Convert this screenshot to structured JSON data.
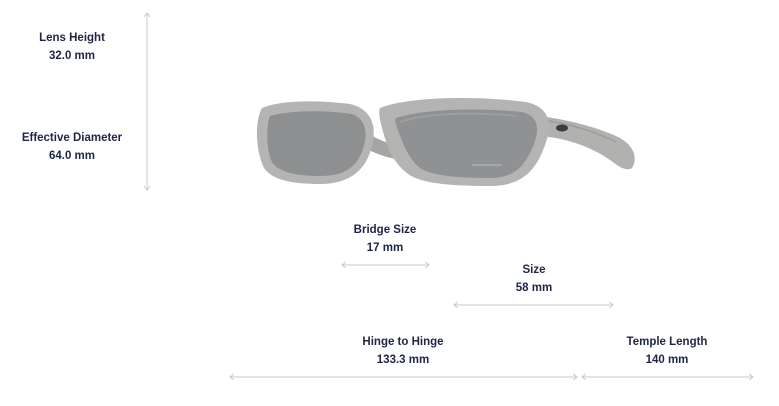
{
  "measurements": {
    "lens_height": {
      "label": "Lens Height",
      "value": "32.0 mm"
    },
    "effective_diameter": {
      "label": "Effective Diameter",
      "value": "64.0 mm"
    },
    "bridge_size": {
      "label": "Bridge Size",
      "value": "17 mm"
    },
    "size": {
      "label": "Size",
      "value": "58 mm"
    },
    "hinge_to_hinge": {
      "label": "Hinge to Hinge",
      "value": "133.3 mm"
    },
    "temple_length": {
      "label": "Temple Length",
      "value": "140 mm"
    }
  },
  "colors": {
    "text": "#1f2545",
    "line": "#c8c8c8",
    "frame": "#b4b5b3",
    "lens": "#8c8e90"
  },
  "icons": [
    "eyewear-product-image",
    "brand-logo-icon"
  ]
}
